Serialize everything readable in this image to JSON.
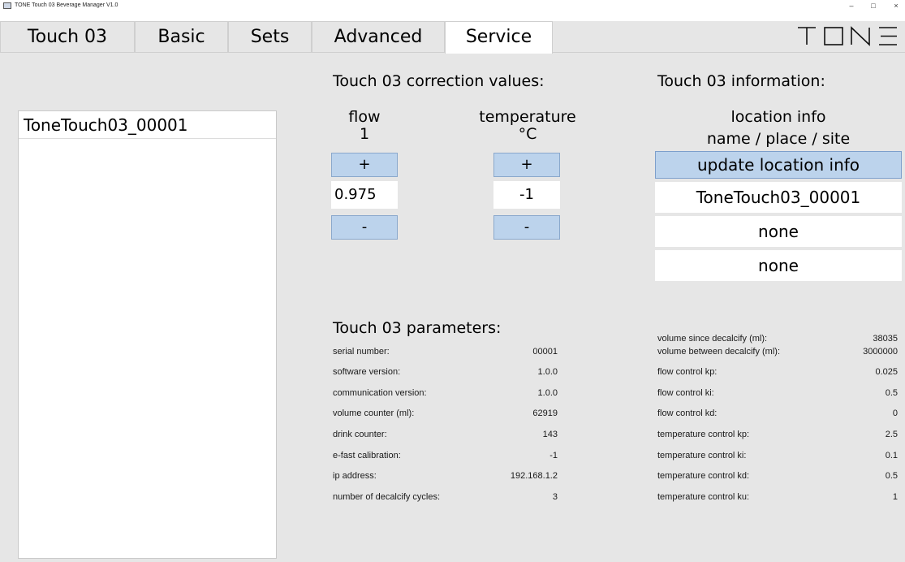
{
  "window": {
    "title": "TONE Touch 03   Beverage Manager   V1.0",
    "minimize": "–",
    "maximize": "□",
    "close": "×"
  },
  "tabs": [
    {
      "label": "Touch 03"
    },
    {
      "label": "Basic"
    },
    {
      "label": "Sets"
    },
    {
      "label": "Advanced"
    },
    {
      "label": "Service",
      "active": true
    }
  ],
  "logo": {
    "text": "TONE"
  },
  "device_list": {
    "items": [
      "ToneTouch03_00001"
    ]
  },
  "correction": {
    "title": "Touch 03 correction values:",
    "flow": {
      "label": "flow",
      "unit": "1",
      "plus": "+",
      "value": "0.975",
      "minus": "-"
    },
    "temperature": {
      "label": "temperature",
      "unit": "°C",
      "plus": "+",
      "value": "-1",
      "minus": "-"
    }
  },
  "information": {
    "title": "Touch 03 information:",
    "subtitle1": "location info",
    "subtitle2": "name / place / site",
    "update_button": "update location info",
    "name": "ToneTouch03_00001",
    "place": "none",
    "site": "none"
  },
  "parameters": {
    "title": "Touch 03 parameters:",
    "left": [
      {
        "label": "serial number:",
        "value": "00001"
      },
      {
        "label": "software version:",
        "value": "1.0.0"
      },
      {
        "label": "communication version:",
        "value": "1.0.0"
      },
      {
        "label": "volume counter (ml):",
        "value": "62919"
      },
      {
        "label": "drink counter:",
        "value": "143"
      },
      {
        "label": "e-fast calibration:",
        "value": "-1"
      },
      {
        "label": "ip address:",
        "value": "192.168.1.2"
      },
      {
        "label": "number of decalcify cycles:",
        "value": "3"
      }
    ],
    "right": [
      {
        "label": "volume since decalcify (ml):",
        "value": "38035"
      },
      {
        "label": "volume between decalcify (ml):",
        "value": "3000000"
      },
      {
        "label": "flow control kp:",
        "value": "0.025"
      },
      {
        "label": "flow control ki:",
        "value": "0.5"
      },
      {
        "label": "flow control kd:",
        "value": "0"
      },
      {
        "label": "temperature control kp:",
        "value": "2.5"
      },
      {
        "label": "temperature control ki:",
        "value": "0.1"
      },
      {
        "label": "temperature control kd:",
        "value": "0.5"
      },
      {
        "label": "temperature control ku:",
        "value": "1"
      }
    ]
  }
}
